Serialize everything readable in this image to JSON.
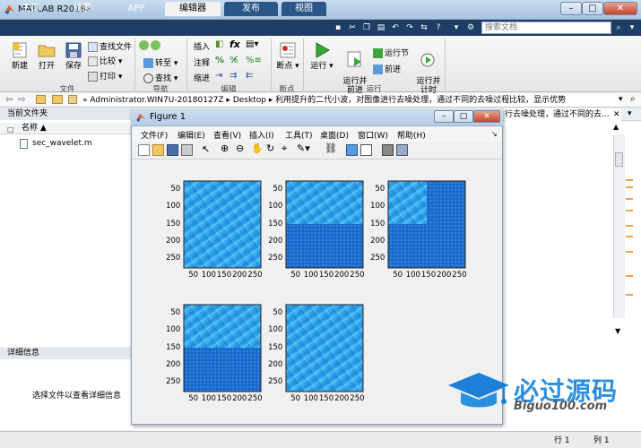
{
  "app": {
    "title": "MATLAB R2018a"
  },
  "tabs": [
    "主页",
    "绘图",
    "APP",
    "编辑器",
    "发布",
    "视图"
  ],
  "active_tab": "编辑器",
  "search": {
    "placeholder": "搜索文档"
  },
  "ribbon": {
    "file": {
      "new": "新建",
      "open": "打开",
      "save": "保存",
      "find_files": "查找文件",
      "compare": "比较",
      "print": "打印",
      "label": "文件"
    },
    "nav": {
      "goto": "转至",
      "find": "查找",
      "label": "导航"
    },
    "edit": {
      "insert": "插入",
      "comment": "注释",
      "indent": "缩进",
      "label": "编辑"
    },
    "breakpoints": {
      "breakpoint": "断点",
      "label": "断点"
    },
    "run": {
      "run": "运行",
      "run_advance": "运行并\n前进",
      "run_section": "运行节",
      "advance": "前进",
      "run_time": "运行并\n计时",
      "label": "运行"
    }
  },
  "address": {
    "path": "« Administrator.WIN7U-20180127Z ▸ Desktop ▸ 利用提升的二代小波，对图像进行去噪处理，通过不同的去噪过程比较，显示优势"
  },
  "left_pane": {
    "title": "当前文件夹",
    "col_name": "名称",
    "files": [
      "sec_wavelet.m"
    ]
  },
  "detail_pane": {
    "title": "详细信息",
    "message": "选择文件以查看详细信息"
  },
  "editor": {
    "tab_text": "行去噪处理，通过不同的去..."
  },
  "status": {
    "row_label": "行",
    "row": "1",
    "col_label": "列",
    "col": "1"
  },
  "figure": {
    "title": "Figure 1",
    "menus": [
      "文件(F)",
      "编辑(E)",
      "查看(V)",
      "插入(I)",
      "工具(T)",
      "桌面(D)",
      "窗口(W)",
      "帮助(H)"
    ],
    "xticks": [
      "50",
      "100",
      "150",
      "200",
      "250"
    ],
    "yticks": [
      "50",
      "100",
      "150",
      "200",
      "250"
    ]
  },
  "watermark": {
    "text": "必过源码",
    "url": "Biguo100.com"
  },
  "colors": {
    "accent": "#1e3e66",
    "image_light": "#3ab0ee",
    "image_dark": "#1f6fcf"
  }
}
